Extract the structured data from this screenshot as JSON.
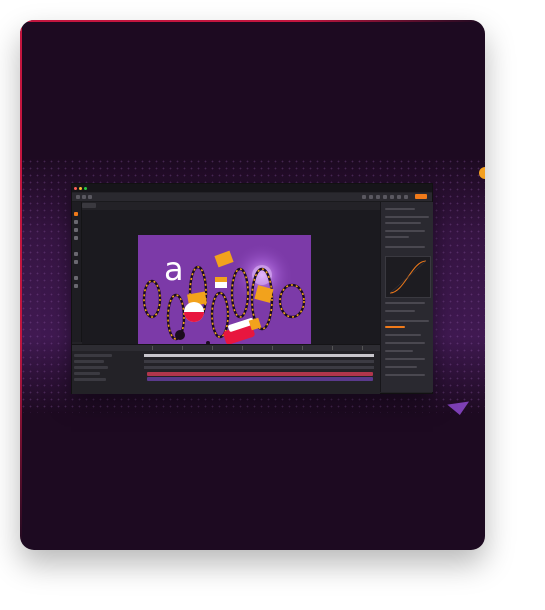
{
  "app": {
    "window_title": "",
    "canvas_text": "a"
  },
  "colors": {
    "card_bg": "#1d0a21",
    "accent_border": "#c3163f",
    "canvas_bg": "#7c3aa8",
    "orange": "#f4a020",
    "toolbar_highlight": "#f07a1a",
    "timeline_bar_red": "#b1364c",
    "timeline_bar_purple": "#5a3a8c"
  },
  "icons": [
    "close-dot-icon",
    "minimize-dot-icon",
    "maximize-dot-icon",
    "orange-circle-icon",
    "purple-triangle-icon"
  ]
}
